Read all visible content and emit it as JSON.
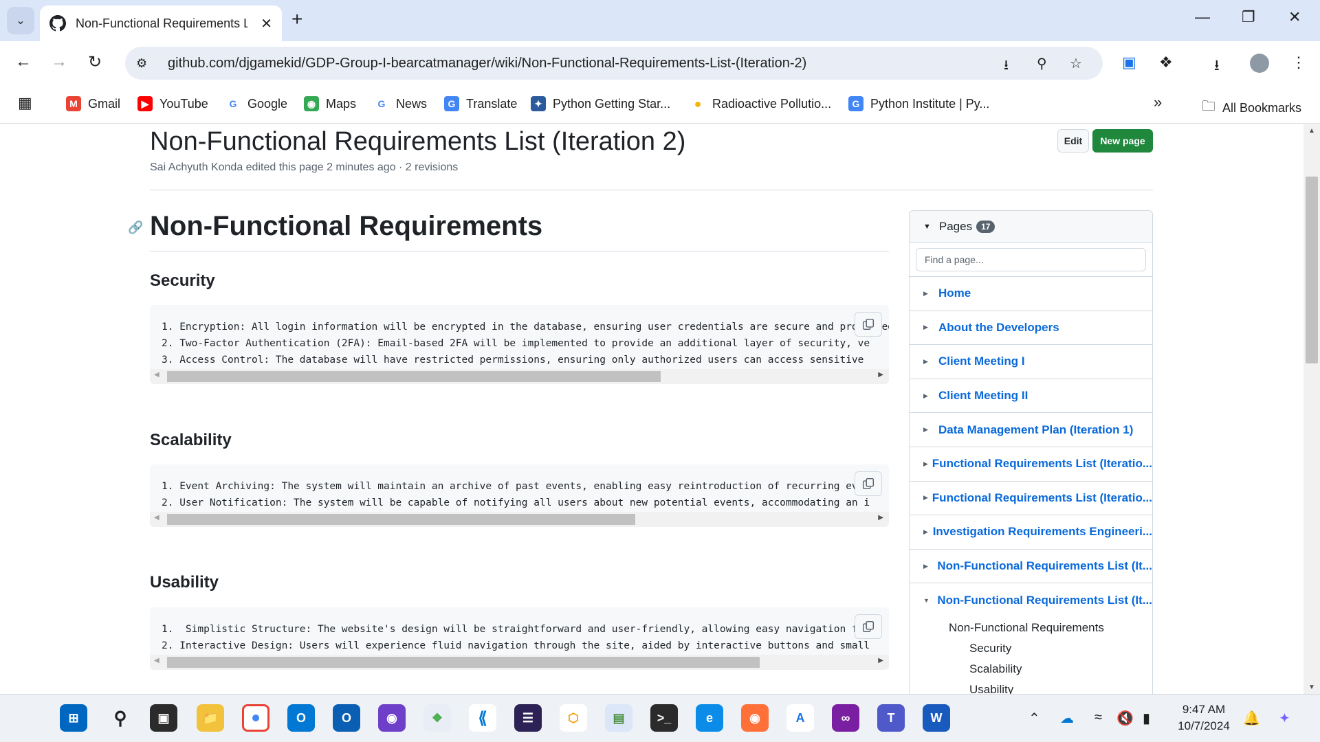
{
  "browser": {
    "tab_title": "Non-Functional Requirements L",
    "url": "github.com/djgamekid/GDP-Group-I-bearcatmanager/wiki/Non-Functional-Requirements-List-(Iteration-2)",
    "bookmarks": [
      {
        "label": "Gmail",
        "icon": "gmail-icon",
        "color": "#ea4335"
      },
      {
        "label": "YouTube",
        "icon": "youtube-icon",
        "color": "#ff0000"
      },
      {
        "label": "Google",
        "icon": "google-icon",
        "color": "#4285f4"
      },
      {
        "label": "Maps",
        "icon": "maps-icon",
        "color": "#34a853"
      },
      {
        "label": "News",
        "icon": "news-icon",
        "color": "#4285f4"
      },
      {
        "label": "Translate",
        "icon": "translate-icon",
        "color": "#4285f4"
      },
      {
        "label": "Python Getting Star...",
        "icon": "python-icon",
        "color": "#2b5b9c"
      },
      {
        "label": "Radioactive Pollutio...",
        "icon": "sun-icon",
        "color": "#f4b400"
      },
      {
        "label": "Python Institute | Py...",
        "icon": "translate-icon",
        "color": "#4285f4"
      }
    ],
    "all_bookmarks_label": "All Bookmarks"
  },
  "page": {
    "title": "Non-Functional Requirements List (Iteration 2)",
    "meta": "Sai Achyuth Konda edited this page 2 minutes ago · 2 revisions",
    "edit_label": "Edit",
    "new_page_label": "New page",
    "heading": "Non-Functional Requirements",
    "sections": [
      {
        "title": "Security",
        "code": "1. Encryption: All login information will be encrypted in the database, ensuring user credentials are secure and protected.\n2. Two-Factor Authentication (2FA): Email-based 2FA will be implemented to provide an additional layer of security, ve\n3. Access Control: The database will have restricted permissions, ensuring only authorized users can access sensitive"
      },
      {
        "title": "Scalability",
        "code": "1. Event Archiving: The system will maintain an archive of past events, enabling easy reintroduction of recurring eve\n2. User Notification: The system will be capable of notifying all users about new potential events, accommodating an i"
      },
      {
        "title": "Usability",
        "code": "1.  Simplistic Structure: The website's design will be straightforward and user-friendly, allowing easy navigation for\n2. Interactive Design: Users will experience fluid navigation through the site, aided by interactive buttons and small"
      }
    ]
  },
  "sidebar": {
    "label": "Pages",
    "count": "17",
    "search_placeholder": "Find a page...",
    "items": [
      "Home",
      "About the Developers",
      "Client Meeting I",
      "Client Meeting II",
      "Data Management Plan (Iteration 1)",
      "Functional Requirements List (Iteratio...",
      "Functional Requirements List (Iteratio...",
      "Investigation Requirements Engineeri...",
      "Non-Functional Requirements List (It...",
      "Non-Functional Requirements List (It..."
    ],
    "toc": {
      "heading": "Non-Functional Requirements",
      "subs": [
        "Security",
        "Scalability",
        "Usability"
      ]
    }
  },
  "taskbar": {
    "time": "9:47 AM",
    "date": "10/7/2024"
  }
}
